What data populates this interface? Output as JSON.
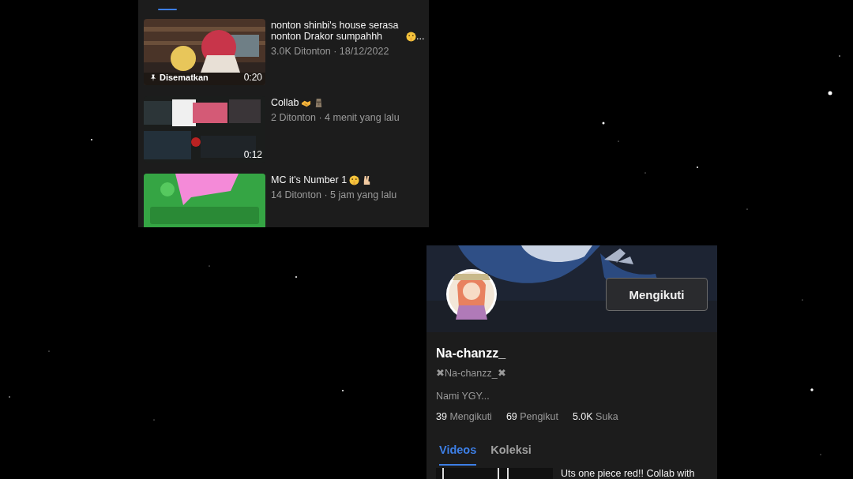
{
  "top_panel": {
    "tab_indicator": {
      "selected": true
    },
    "videos": [
      {
        "title": "nonton shinbi's house serasa nonton Drakor  sumpahhh",
        "icons": [
          {
            "kind": "shush"
          }
        ],
        "title_end": "...",
        "meta": "3.0K Ditonton · 18/12/2022",
        "pinned": true,
        "pin_label": "Disematkan",
        "duration": "0:20",
        "thumb": {
          "kind": "anime"
        }
      },
      {
        "title": "Collab",
        "icons": [
          {
            "kind": "handshake"
          },
          {
            "kind": "moai"
          }
        ],
        "meta": "2 Ditonton · 4 menit yang lalu",
        "pinned": false,
        "duration": "0:12",
        "thumb": {
          "kind": "screens"
        }
      },
      {
        "title": "MC it's Number 1",
        "icons": [
          {
            "kind": "shush"
          },
          {
            "kind": "peace"
          }
        ],
        "meta": "14 Ditonton · 5 jam yang lalu",
        "pinned": false,
        "thumb": {
          "kind": "green"
        }
      }
    ]
  },
  "profile": {
    "follow_button": "Mengikuti",
    "name": "Na-chanzz_",
    "handle": "✖Na-chanzz_✖",
    "bio": "Nami YGY...",
    "stats": [
      {
        "text": "39 Mengikuti"
      },
      {
        "text": "69 Pengikut"
      },
      {
        "text": "5.0K Suka"
      }
    ],
    "tabs": [
      {
        "label": "Videos",
        "selected": true
      },
      {
        "label": "Koleksi",
        "selected": false
      }
    ],
    "next_video_title": "Uts one piece red!! Collab with"
  }
}
